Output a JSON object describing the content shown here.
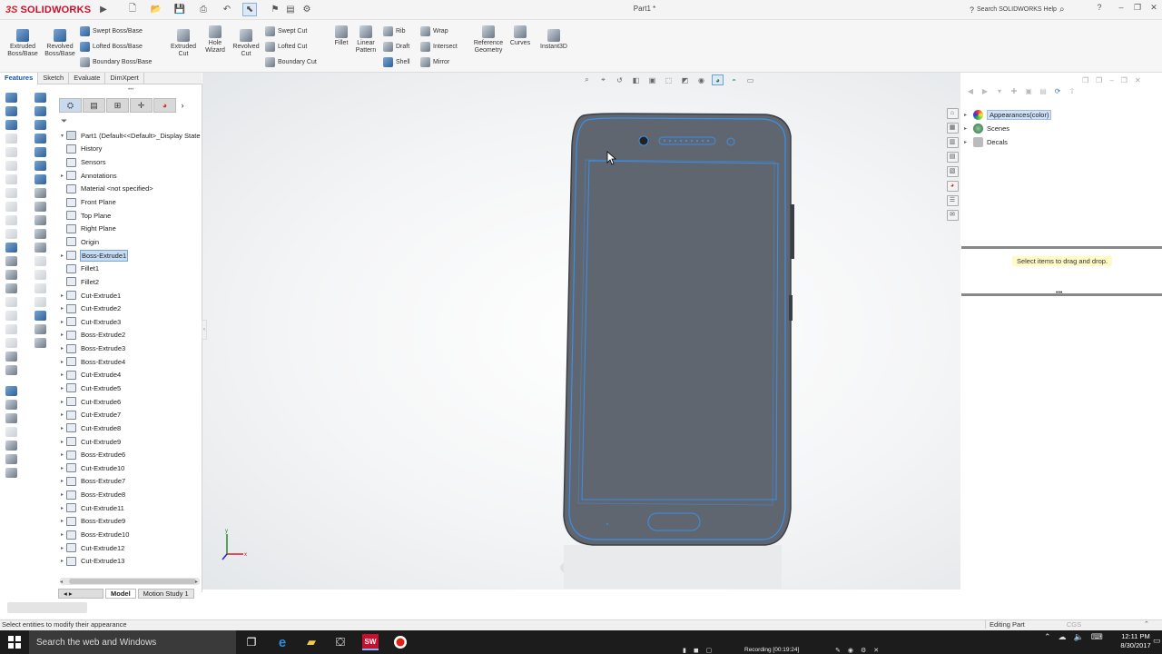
{
  "app": {
    "brand": "SOLIDWORKS",
    "brand_prefix": "3S",
    "document_title": "Part1 *",
    "help_search_placeholder": "Search SOLIDWORKS Help"
  },
  "command_manager": {
    "big_buttons": [
      {
        "label": "Extruded Boss/Base",
        "icon": "extruded-boss-icon"
      },
      {
        "label": "Revolved Boss/Base",
        "icon": "revolved-boss-icon"
      },
      {
        "label": "Extruded Cut",
        "icon": "extruded-cut-icon"
      },
      {
        "label": "Hole Wizard",
        "icon": "hole-wizard-icon"
      },
      {
        "label": "Revolved Cut",
        "icon": "revolved-cut-icon"
      },
      {
        "label": "Fillet",
        "icon": "fillet-icon"
      },
      {
        "label": "Linear Pattern",
        "icon": "linear-pattern-icon"
      },
      {
        "label": "Reference Geometry",
        "icon": "reference-geometry-icon"
      },
      {
        "label": "Curves",
        "icon": "curves-icon"
      },
      {
        "label": "Instant3D",
        "icon": "instant3d-icon"
      }
    ],
    "small_buttons": {
      "swept_boss": "Swept Boss/Base",
      "lofted_boss": "Lofted Boss/Base",
      "boundary_boss": "Boundary Boss/Base",
      "swept_cut": "Swept Cut",
      "lofted_cut": "Lofted Cut",
      "boundary_cut": "Boundary Cut",
      "rib": "Rib",
      "draft": "Draft",
      "shell": "Shell",
      "wrap": "Wrap",
      "intersect": "Intersect",
      "mirror": "Mirror"
    },
    "tabs": [
      "Features",
      "Sketch",
      "Evaluate",
      "DimXpert"
    ]
  },
  "feature_tree": {
    "root": "Part1  (Default<<Default>_Display State",
    "items": [
      {
        "label": "History",
        "expandable": false
      },
      {
        "label": "Sensors",
        "expandable": false
      },
      {
        "label": "Annotations",
        "expandable": true
      },
      {
        "label": "Material <not specified>",
        "expandable": false
      },
      {
        "label": "Front Plane",
        "expandable": false
      },
      {
        "label": "Top Plane",
        "expandable": false
      },
      {
        "label": "Right Plane",
        "expandable": false
      },
      {
        "label": "Origin",
        "expandable": false
      },
      {
        "label": "Boss-Extrude1",
        "expandable": true,
        "selected": true
      },
      {
        "label": "Fillet1",
        "expandable": false
      },
      {
        "label": "Fillet2",
        "expandable": false
      },
      {
        "label": "Cut-Extrude1",
        "expandable": true
      },
      {
        "label": "Cut-Extrude2",
        "expandable": true
      },
      {
        "label": "Cut-Extrude3",
        "expandable": true
      },
      {
        "label": "Boss-Extrude2",
        "expandable": true
      },
      {
        "label": "Boss-Extrude3",
        "expandable": true
      },
      {
        "label": "Boss-Extrude4",
        "expandable": true
      },
      {
        "label": "Cut-Extrude4",
        "expandable": true
      },
      {
        "label": "Cut-Extrude5",
        "expandable": true
      },
      {
        "label": "Cut-Extrude6",
        "expandable": true
      },
      {
        "label": "Cut-Extrude7",
        "expandable": true
      },
      {
        "label": "Cut-Extrude8",
        "expandable": true
      },
      {
        "label": "Cut-Extrude9",
        "expandable": true
      },
      {
        "label": "Boss-Extrude6",
        "expandable": true
      },
      {
        "label": "Cut-Extrude10",
        "expandable": true
      },
      {
        "label": "Boss-Extrude7",
        "expandable": true
      },
      {
        "label": "Boss-Extrude8",
        "expandable": true
      },
      {
        "label": "Cut-Extrude11",
        "expandable": true
      },
      {
        "label": "Boss-Extrude9",
        "expandable": true
      },
      {
        "label": "Boss-Extrude10",
        "expandable": true
      },
      {
        "label": "Cut-Extrude12",
        "expandable": true
      },
      {
        "label": "Cut-Extrude13",
        "expandable": true
      }
    ],
    "bottom_tabs": [
      "Model",
      "Motion Study 1"
    ]
  },
  "task_pane": {
    "items": [
      {
        "label": "Appearances(color)",
        "selected": true
      },
      {
        "label": "Scenes",
        "selected": false
      },
      {
        "label": "Decals",
        "selected": false
      }
    ],
    "hint": "Select items to drag and drop."
  },
  "status_bar": {
    "message": "Select entities to modify their appearance",
    "mode": "Editing Part",
    "units": "CGS"
  },
  "taskbar": {
    "search_placeholder": "Search the web and Windows",
    "recording": "Recording [00:19:24]",
    "time": "12:11 PM",
    "date": "8/30/2017"
  },
  "colors": {
    "brand_red": "#c8102e",
    "phone_body": "#5f6670",
    "phone_edge": "#3b8fe8",
    "selection_blue": "#c5dcf5"
  }
}
